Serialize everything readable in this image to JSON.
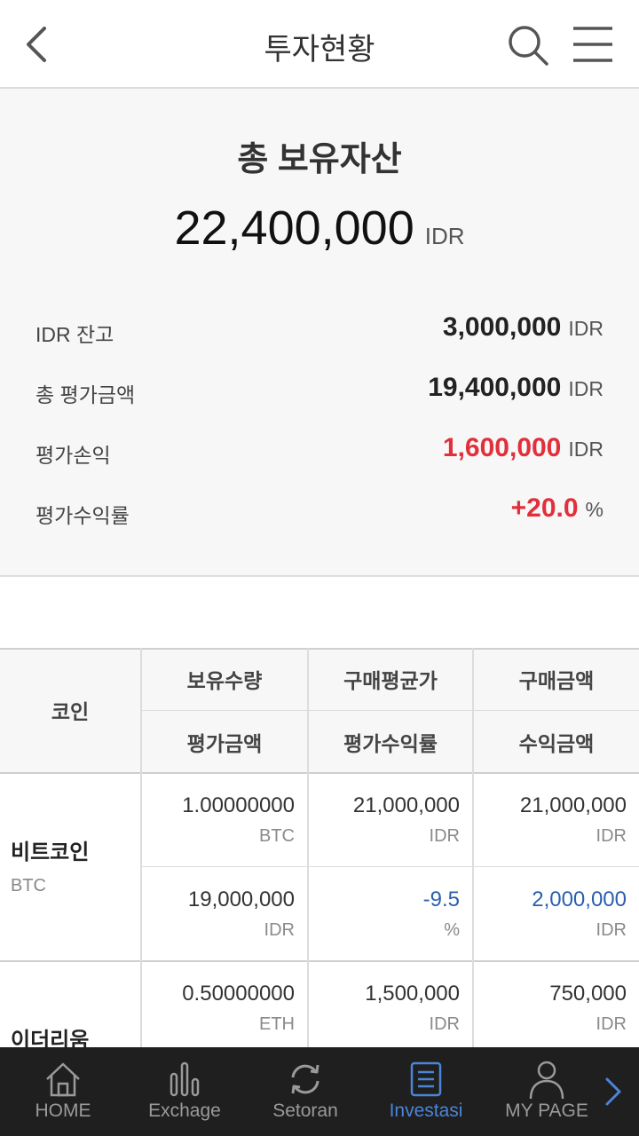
{
  "header": {
    "title": "투자현황",
    "back_icon": "chevron-left-icon",
    "search_icon": "search-icon",
    "menu_icon": "hamburger-menu-icon"
  },
  "summary": {
    "title": "총 보유자산",
    "total": "22,400,000",
    "total_unit": "IDR",
    "rows": [
      {
        "label": "IDR 잔고",
        "value": "3,000,000",
        "unit": "IDR"
      },
      {
        "label": "총 평가금액",
        "value": "19,400,000",
        "unit": "IDR"
      },
      {
        "label": "평가손익",
        "value": "1,600,000",
        "unit": "IDR"
      },
      {
        "label": "평가수익률",
        "value": "+20.0",
        "unit": "%"
      }
    ],
    "colors": {
      "positive": "#e1303b",
      "negative": "#2a5fb0"
    }
  },
  "table": {
    "headers": {
      "coin": "코인",
      "top": [
        "보유수량",
        "구매평균가",
        "구매금액"
      ],
      "bottom": [
        "평가금액",
        "평가수익률",
        "수익금액"
      ]
    },
    "rows": [
      {
        "name": "비트코인",
        "symbol": "BTC",
        "top": [
          {
            "value": "1.00000000",
            "unit": "BTC"
          },
          {
            "value": "21,000,000",
            "unit": "IDR"
          },
          {
            "value": "21,000,000",
            "unit": "IDR"
          }
        ],
        "bottom": [
          {
            "value": "19,000,000",
            "unit": "IDR"
          },
          {
            "value": "-9.5",
            "unit": "%"
          },
          {
            "value": "2,000,000",
            "unit": "IDR"
          }
        ]
      },
      {
        "name": "이더리움",
        "top": [
          {
            "value": "0.50000000",
            "unit": "ETH"
          },
          {
            "value": "1,500,000",
            "unit": "IDR"
          },
          {
            "value": "750,000",
            "unit": "IDR"
          }
        ]
      }
    ]
  },
  "tabbar": {
    "tabs": [
      {
        "label": "HOME",
        "icon": "home-icon"
      },
      {
        "label": "Exchage",
        "icon": "bar-chart-icon"
      },
      {
        "label": "Setoran",
        "icon": "refresh-icon"
      },
      {
        "label": "Investasi",
        "icon": "document-list-icon",
        "active": true
      },
      {
        "label": "MY PAGE",
        "icon": "user-icon"
      }
    ],
    "next_icon": "chevron-right-icon",
    "active_color": "#4a86d8"
  }
}
